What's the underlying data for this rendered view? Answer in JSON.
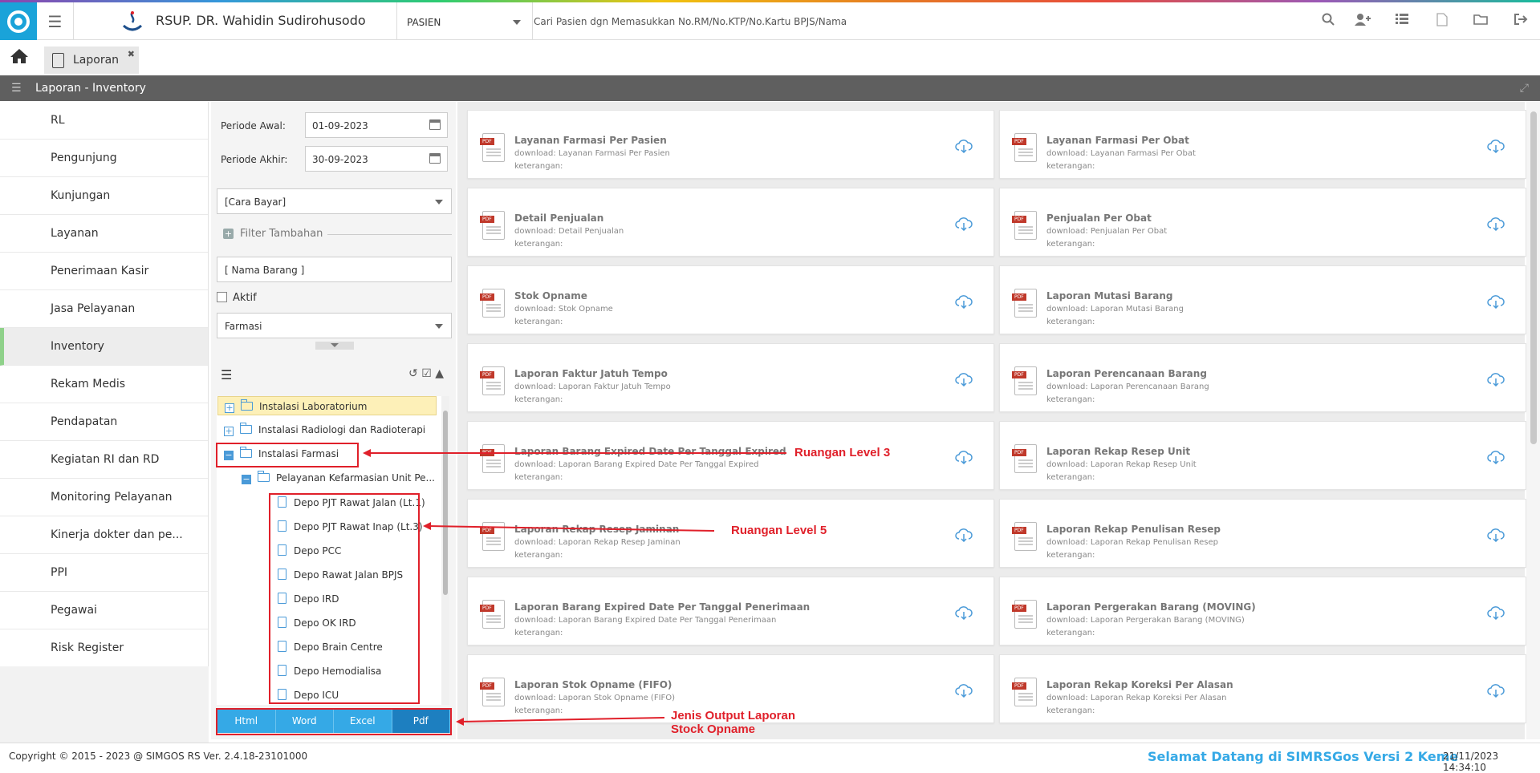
{
  "header": {
    "hospital": "RSUP. DR. Wahidin Sudirohusodo",
    "select_value": "PASIEN",
    "search_placeholder": "Cari Pasien dgn Memasukkan No.RM/No.KTP/No.Kartu BPJS/Nama",
    "icons": [
      "search-icon",
      "add-user-icon",
      "list-icon",
      "pdf-icon",
      "folder-icon",
      "logout-icon"
    ]
  },
  "tabs": {
    "active": "Laporan"
  },
  "title": "Laporan - Inventory",
  "sidebar": {
    "items": [
      {
        "label": "RL"
      },
      {
        "label": "Pengunjung"
      },
      {
        "label": "Kunjungan"
      },
      {
        "label": "Layanan"
      },
      {
        "label": "Penerimaan Kasir"
      },
      {
        "label": "Jasa Pelayanan"
      },
      {
        "label": "Inventory"
      },
      {
        "label": "Rekam Medis"
      },
      {
        "label": "Pendapatan"
      },
      {
        "label": "Kegiatan RI dan RD"
      },
      {
        "label": "Monitoring Pelayanan"
      },
      {
        "label": "Kinerja dokter dan pe..."
      },
      {
        "label": "PPI"
      },
      {
        "label": "Pegawai"
      },
      {
        "label": "Risk Register"
      }
    ],
    "active": "Inventory"
  },
  "filter": {
    "periode_awal_label": "Periode Awal:",
    "periode_awal": "01-09-2023",
    "periode_akhir_label": "Periode Akhir:",
    "periode_akhir": "30-09-2023",
    "cara_bayar": "[Cara Bayar]",
    "filter_tambahan": "Filter Tambahan",
    "nama_barang_placeholder": "[ Nama Barang ]",
    "aktif_label": "Aktif",
    "farmasi": "Farmasi"
  },
  "tree": {
    "nodes": [
      {
        "label": "Instalasi Laboratorium"
      },
      {
        "label": "Instalasi Radiologi dan Radioterapi"
      },
      {
        "label": "Instalasi Farmasi"
      },
      {
        "label": "Pelayanan Kefarmasian Unit Pe..."
      },
      {
        "label": "Depo PJT Rawat Jalan (Lt.1)"
      },
      {
        "label": "Depo PJT Rawat Inap (Lt.3)"
      },
      {
        "label": "Depo PCC"
      },
      {
        "label": "Depo Rawat Jalan BPJS"
      },
      {
        "label": "Depo IRD"
      },
      {
        "label": "Depo OK IRD"
      },
      {
        "label": "Depo Brain Centre"
      },
      {
        "label": "Depo Hemodialisa"
      },
      {
        "label": "Depo ICU"
      }
    ]
  },
  "output_buttons": {
    "html": "Html",
    "word": "Word",
    "excel": "Excel",
    "pdf": "Pdf"
  },
  "reports": [
    {
      "title": "Layanan Farmasi Per Pasien",
      "download": "download: Layanan Farmasi Per Pasien",
      "ket": "keterangan:"
    },
    {
      "title": "Layanan Farmasi Per Obat",
      "download": "download: Layanan Farmasi Per Obat",
      "ket": "keterangan:"
    },
    {
      "title": "Detail Penjualan",
      "download": "download: Detail Penjualan",
      "ket": "keterangan:"
    },
    {
      "title": "Penjualan Per Obat",
      "download": "download: Penjualan Per Obat",
      "ket": "keterangan:"
    },
    {
      "title": "Stok Opname",
      "download": "download: Stok Opname",
      "ket": "keterangan:"
    },
    {
      "title": "Laporan Mutasi Barang",
      "download": "download: Laporan Mutasi Barang",
      "ket": "keterangan:"
    },
    {
      "title": "Laporan Faktur Jatuh Tempo",
      "download": "download: Laporan Faktur Jatuh Tempo",
      "ket": "keterangan:"
    },
    {
      "title": "Laporan Perencanaan Barang",
      "download": "download: Laporan Perencanaan Barang",
      "ket": "keterangan:"
    },
    {
      "title": "Laporan Barang Expired Date Per Tanggal Expired",
      "download": "download: Laporan Barang Expired Date Per Tanggal Expired",
      "ket": "keterangan:"
    },
    {
      "title": "Laporan Rekap Resep Unit",
      "download": "download: Laporan Rekap Resep Unit",
      "ket": "keterangan:"
    },
    {
      "title": "Laporan Rekap Resep Jaminan",
      "download": "download: Laporan Rekap Resep Jaminan",
      "ket": "keterangan:"
    },
    {
      "title": "Laporan Rekap Penulisan Resep",
      "download": "download: Laporan Rekap Penulisan Resep",
      "ket": "keterangan:"
    },
    {
      "title": "Laporan Barang Expired Date Per Tanggal Penerimaan",
      "download": "download: Laporan Barang Expired Date Per Tanggal Penerimaan",
      "ket": "keterangan:"
    },
    {
      "title": "Laporan Pergerakan Barang (MOVING)",
      "download": "download: Laporan Pergerakan Barang (MOVING)",
      "ket": "keterangan:"
    },
    {
      "title": "Laporan Stok Opname (FIFO)",
      "download": "download: Laporan Stok Opname (FIFO)",
      "ket": "keterangan:"
    },
    {
      "title": "Laporan Rekap Koreksi Per Alasan",
      "download": "download: Laporan Rekap Koreksi Per Alasan",
      "ket": "keterangan:"
    }
  ],
  "annotations": {
    "level3": "Ruangan Level 3",
    "level5": "Ruangan Level 5",
    "output1": "Jenis Output Laporan",
    "output2": "Stock Opname",
    "color": "#e0202a"
  },
  "footer": {
    "copyright": "Copyright © 2015 - 2023 @ SIMGOS RS Ver. 2.4.18-23101000",
    "welcome": "Selamat Datang di SIMRSGos Versi 2 Keme",
    "datetime": "21/11/2023 14:34:10"
  }
}
